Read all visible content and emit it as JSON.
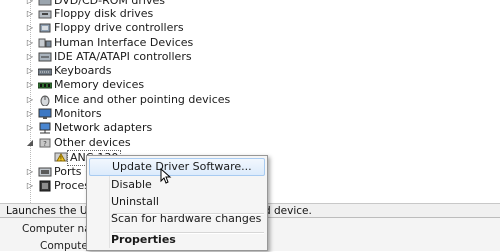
{
  "tree": {
    "items": [
      {
        "label": "DVD/CD-ROM drives",
        "icon": "dvd-drive-icon"
      },
      {
        "label": "Floppy disk drives",
        "icon": "floppy-disk-icon"
      },
      {
        "label": "Floppy drive controllers",
        "icon": "controller-icon"
      },
      {
        "label": "Human Interface Devices",
        "icon": "hid-icon"
      },
      {
        "label": "IDE ATA/ATAPI controllers",
        "icon": "ide-controller-icon"
      },
      {
        "label": "Keyboards",
        "icon": "keyboard-icon"
      },
      {
        "label": "Memory devices",
        "icon": "memory-icon"
      },
      {
        "label": "Mice and other pointing devices",
        "icon": "mouse-icon"
      },
      {
        "label": "Monitors",
        "icon": "monitor-icon"
      },
      {
        "label": "Network adapters",
        "icon": "network-adapter-icon"
      },
      {
        "label": "Other devices",
        "icon": "other-devices-icon"
      },
      {
        "label": "ANC-130",
        "icon": "unknown-device-icon"
      },
      {
        "label": "Ports (C",
        "icon": "port-icon"
      },
      {
        "label": "Process",
        "icon": "processor-icon"
      }
    ]
  },
  "context_menu": {
    "update": "Update Driver Software...",
    "disable": "Disable",
    "uninstall": "Uninstall",
    "scan": "Scan for hardware changes",
    "properties": "Properties"
  },
  "statusbar": {
    "left": "Launches the Upda",
    "right": "d device."
  },
  "lower": {
    "row1": "Computer nam",
    "row2": "Computer na"
  }
}
